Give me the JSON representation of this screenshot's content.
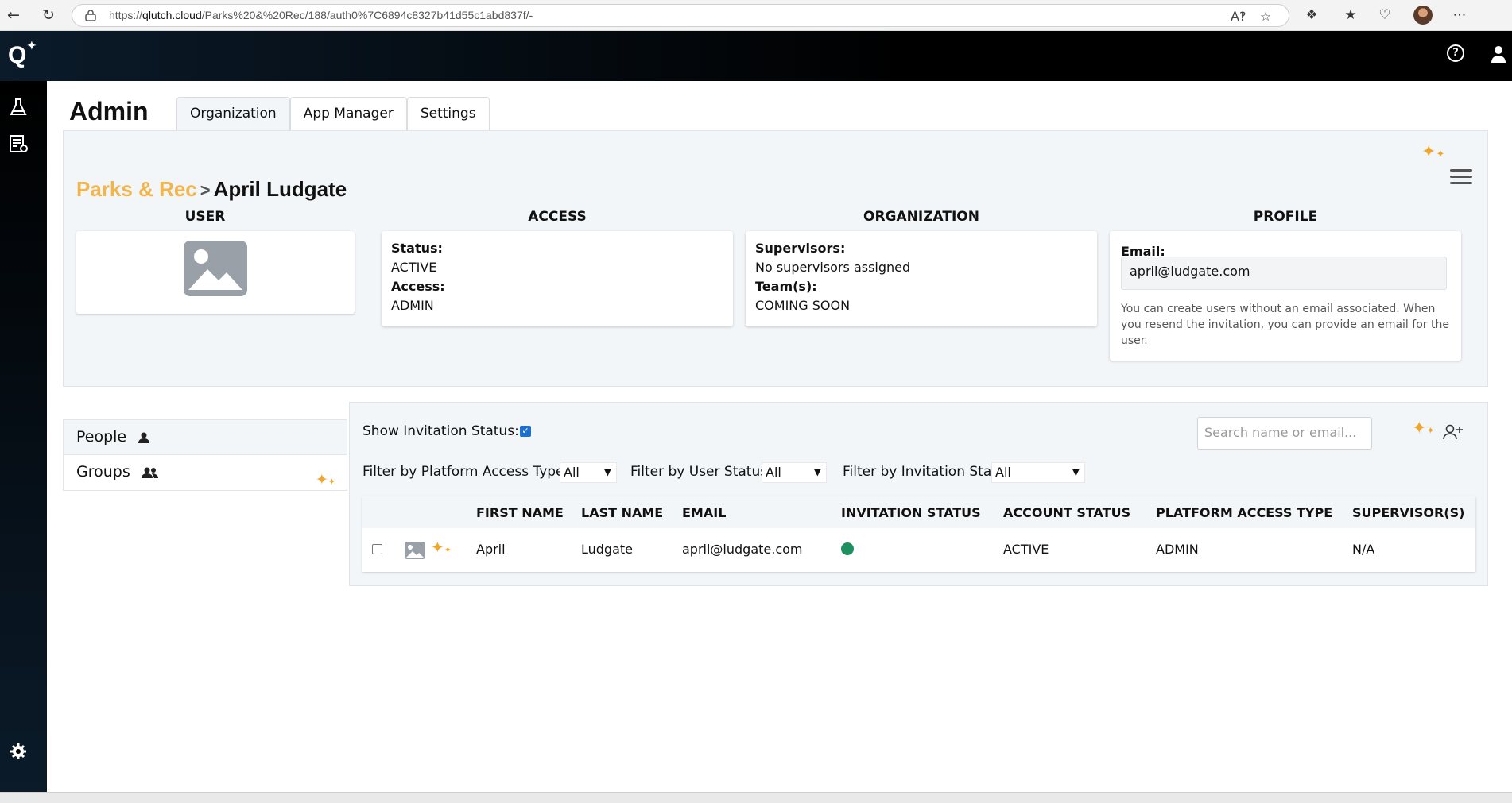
{
  "browser": {
    "url_prefix": "https://",
    "url_host": "qlutch.cloud",
    "url_path": "/Parks%20&%20Rec/188/auth0%7C6894c8327b41d55c1abd837f/-"
  },
  "app": {
    "logo_letter": "Q",
    "help_glyph": "?"
  },
  "header": {
    "title": "Admin",
    "tabs": [
      {
        "label": "Organization"
      },
      {
        "label": "App Manager"
      },
      {
        "label": "Settings"
      }
    ]
  },
  "breadcrumb": {
    "org": "Parks & Rec",
    "separator": ">",
    "user": "April Ludgate"
  },
  "columns": {
    "user": "USER",
    "access": "ACCESS",
    "organization": "ORGANIZATION",
    "profile": "PROFILE"
  },
  "access_card": {
    "status_label": "Status:",
    "status_value": "ACTIVE",
    "access_label": "Access:",
    "access_value": "ADMIN"
  },
  "org_card": {
    "supervisors_label": "Supervisors:",
    "supervisors_value": "No supervisors assigned",
    "teams_label": "Team(s):",
    "teams_value": "COMING SOON"
  },
  "profile_card": {
    "email_label": "Email:",
    "email_value": "april@ludgate.com",
    "help_text": "You can create users without an email associated. When you resend the invitation, you can provide an email for the user."
  },
  "left_tabs": [
    {
      "label": "People"
    },
    {
      "label": "Groups"
    }
  ],
  "people": {
    "show_invitation_label": "Show Invitation Status:",
    "search_placeholder": "Search name or email...",
    "filters": [
      {
        "label": "Filter by Platform Access Type:",
        "value": "All"
      },
      {
        "label": "Filter by User Status:",
        "value": "All"
      },
      {
        "label": "Filter by Invitation Status:",
        "value": "All"
      }
    ],
    "table": {
      "headers": [
        "FIRST NAME",
        "LAST NAME",
        "EMAIL",
        "INVITATION STATUS",
        "ACCOUNT STATUS",
        "PLATFORM ACCESS TYPE",
        "SUPERVISOR(S)"
      ],
      "rows": [
        {
          "first_name": "April",
          "last_name": "Ludgate",
          "email": "april@ludgate.com",
          "account_status": "ACTIVE",
          "platform_access": "ADMIN",
          "supervisors": "N/A"
        }
      ]
    }
  },
  "colors": {
    "accent_gold": "#f2b54c",
    "status_active": "#1e8f5e",
    "panel_bg": "#f2f6f9"
  },
  "icons": [
    "back-icon",
    "refresh-icon",
    "lock-icon",
    "read-aloud-icon",
    "favorite-icon",
    "extensions-icon",
    "favorites-icon",
    "health-icon",
    "more-icon",
    "help-icon",
    "user-icon",
    "flask-icon",
    "report-icon",
    "image-placeholder-icon",
    "sparkle-icon",
    "hamburger-icon",
    "person-icon",
    "group-icon",
    "add-user-icon",
    "gear-icon"
  ]
}
